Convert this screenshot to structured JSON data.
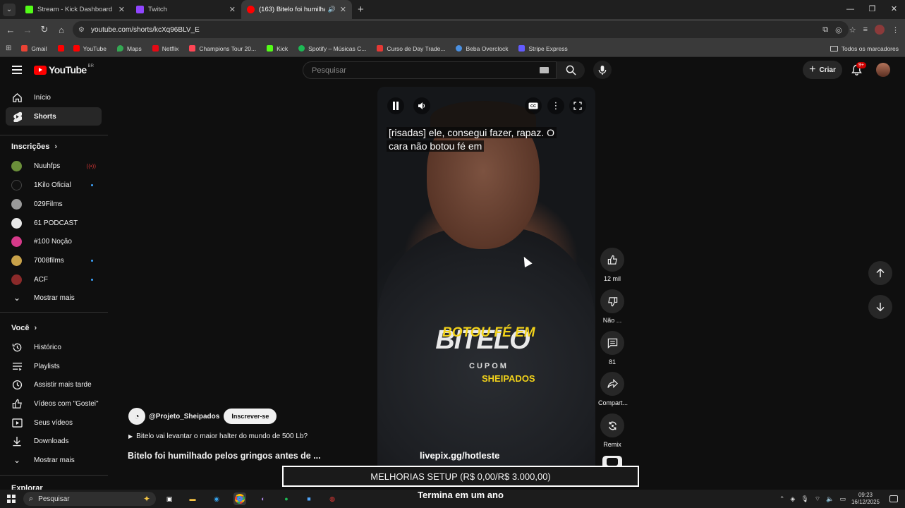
{
  "browser": {
    "tabs": [
      {
        "title": "Stream - Kick Dashboard",
        "favicon_color": "#53fc18"
      },
      {
        "title": "Twitch",
        "favicon_color": "#9146ff"
      },
      {
        "title": "(163) Bitelo foi humilhado",
        "favicon_color": "#ff0000"
      }
    ],
    "url": "youtube.com/shorts/kcXq96BLV_E",
    "bookmarks": [
      {
        "label": "Gmail",
        "color": "#ea4335"
      },
      {
        "label": "",
        "color": "#ff0000"
      },
      {
        "label": "YouTube",
        "color": "#ff0000"
      },
      {
        "label": "Maps",
        "color": "#34a853"
      },
      {
        "label": "Netflix",
        "color": "#e50914"
      },
      {
        "label": "Champions Tour 20...",
        "color": "#ff4655"
      },
      {
        "label": "Kick",
        "color": "#53fc18"
      },
      {
        "label": "Spotify – Músicas C...",
        "color": "#1db954"
      },
      {
        "label": "Curso de Day Trade...",
        "color": "#e53935"
      },
      {
        "label": "Beba Overclock",
        "color": "#4a90e2"
      },
      {
        "label": "Stripe Express",
        "color": "#635bff"
      }
    ],
    "all_bookmarks": "Todos os marcadores"
  },
  "youtube": {
    "logo": "YouTube",
    "region": "BR",
    "search_placeholder": "Pesquisar",
    "create_label": "Criar",
    "notif_badge": "9+"
  },
  "sidebar": {
    "home": "Início",
    "shorts": "Shorts",
    "subs_header": "Inscrições",
    "subs": [
      {
        "name": "Nuuhfps",
        "color": "#6b8f3a",
        "status": "live"
      },
      {
        "name": "1Kilo Oficial",
        "color": "#111111",
        "status": "dot"
      },
      {
        "name": "029Films",
        "color": "#9a9a9a",
        "status": ""
      },
      {
        "name": "61 PODCAST",
        "color": "#e8e8e8",
        "status": ""
      },
      {
        "name": "#100 Noção",
        "color": "#d63a8a",
        "status": ""
      },
      {
        "name": "7008films",
        "color": "#c8a24a",
        "status": "dot"
      },
      {
        "name": "ACF",
        "color": "#8b2a2a",
        "status": "dot"
      }
    ],
    "show_more_1": "Mostrar mais",
    "you_header": "Você",
    "you_items": [
      "Histórico",
      "Playlists",
      "Assistir mais tarde",
      "Vídeos com \"Gostei\"",
      "Seus vídeos",
      "Downloads"
    ],
    "show_more_2": "Mostrar mais",
    "explore": "Explorar"
  },
  "video": {
    "caption_line1": "[risadas] ele, consegui fazer, rapaz. O",
    "caption_line2": "cara não botou fé em",
    "shirt_brand": "BITELO",
    "shirt_tagline": "BOTOU FÉ EM",
    "shirt_cupom": "CUPOM",
    "shirt_sheipados": "SHEIPADOS",
    "link": "livepix.gg/hotleste"
  },
  "actions": {
    "likes": "12 mil",
    "dislike": "Não ...",
    "comments": "81",
    "share": "Compart...",
    "remix": "Remix"
  },
  "channel": {
    "handle": "@Projeto_Sheipados",
    "subscribe": "Inscrever-se",
    "related": "Bitelo vai levantar o maior halter do mundo de 500 Lb?",
    "title": "Bitelo foi humilhado pelos gringos antes de ..."
  },
  "overlay": {
    "goal": "MELHORIAS SETUP (R$ 0,00/R$ 3.000,00)",
    "goal_progress": 0,
    "goal_sub": "Termina em um ano"
  },
  "taskbar": {
    "search": "Pesquisar",
    "time": "09:23",
    "date": "16/12/2025"
  }
}
